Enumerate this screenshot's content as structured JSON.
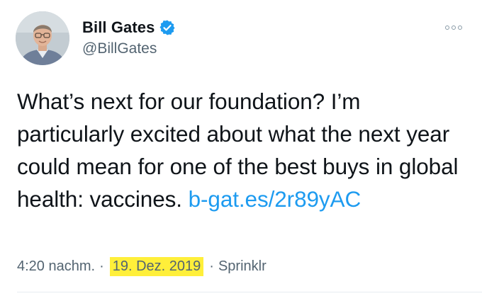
{
  "author": {
    "display_name": "Bill Gates",
    "handle": "@BillGates",
    "verified": true,
    "avatar_icon": "profile-photo"
  },
  "more_icon": "more-options-icon",
  "tweet": {
    "text_before_link": "What’s next for our foundation? I’m particularly excited about what the next year could mean for one of the best buys in global health: vaccines. ",
    "link": "b-gat.es/2r89yAC"
  },
  "meta": {
    "time": "4:20 nachm.",
    "separator": "·",
    "date": "19. Dez. 2019",
    "source": "Sprinklr"
  },
  "colors": {
    "link": "#1d9bf0",
    "verified_badge": "#1d9bf0",
    "highlight": "#ffef3a",
    "secondary_text": "#536471"
  }
}
